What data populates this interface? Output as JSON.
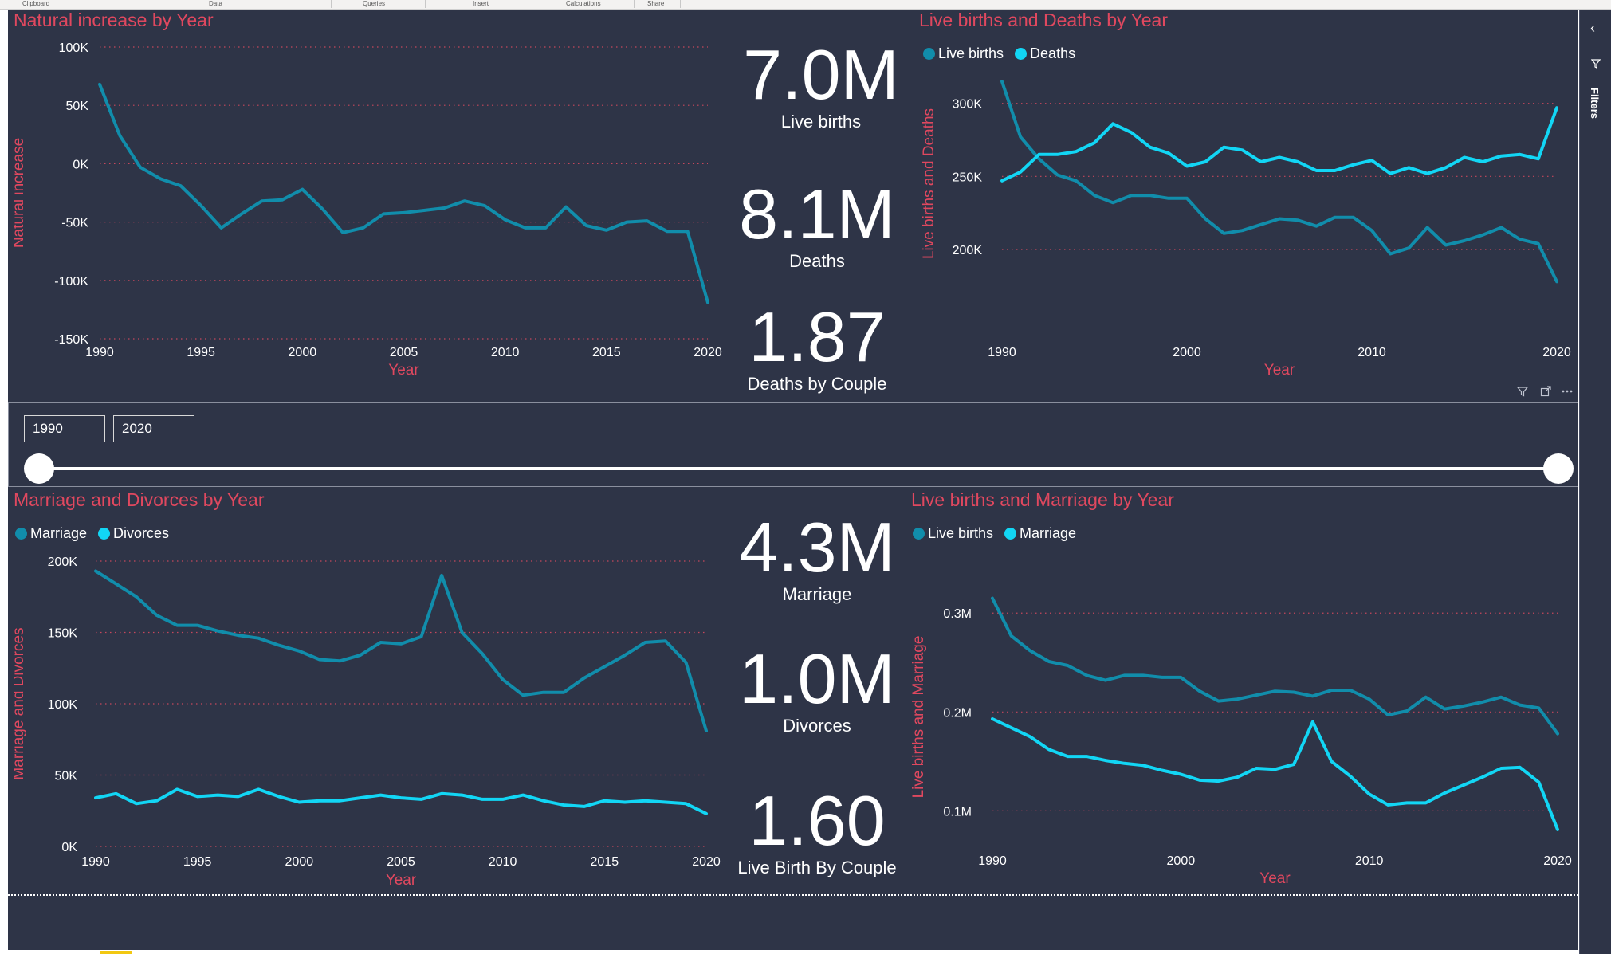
{
  "ribbon": {
    "tabs": [
      "Clipboard",
      "Data",
      "Queries",
      "Insert",
      "Calculations",
      "Share"
    ]
  },
  "filters_pane": {
    "label": "Filters",
    "collapse_icon": "chevron-left-icon",
    "funnel_icon": "funnel-icon"
  },
  "colors": {
    "canvas": "#2e3447",
    "title": "#e0485f",
    "series_dark": "#118dab",
    "series_light": "#12d6f5",
    "text": "#ffffff"
  },
  "kpis": [
    {
      "value": "7.0M",
      "label": "Live births"
    },
    {
      "value": "8.1M",
      "label": "Deaths"
    },
    {
      "value": "1.87",
      "label": "Deaths by Couple"
    },
    {
      "value": "4.3M",
      "label": "Marriage"
    },
    {
      "value": "1.0M",
      "label": "Divorces"
    },
    {
      "value": "1.60",
      "label": "Live Birth By Couple"
    }
  ],
  "slicer": {
    "start": "1990",
    "end": "2020"
  },
  "visual_header_icons": [
    "filter-icon",
    "focus-mode-icon",
    "more-options-icon"
  ],
  "charts": {
    "natural_increase": {
      "title": "Natural increase by Year",
      "chart_data": {
        "type": "line",
        "title": "Natural increase by Year",
        "xlabel": "Year",
        "ylabel": "Natural increase",
        "x": [
          1990,
          1991,
          1992,
          1993,
          1994,
          1995,
          1996,
          1997,
          1998,
          1999,
          2000,
          2001,
          2002,
          2003,
          2004,
          2005,
          2006,
          2007,
          2008,
          2009,
          2010,
          2011,
          2012,
          2013,
          2014,
          2015,
          2016,
          2017,
          2018,
          2019,
          2020
        ],
        "series": [
          {
            "values": [
              68000,
              24000,
              -3000,
              -13000,
              -19000,
              -36000,
              -55000,
              -43000,
              -32000,
              -31000,
              -22000,
              -39000,
              -59000,
              -55000,
              -43000,
              -42000,
              -40000,
              -38000,
              -32000,
              -36000,
              -48000,
              -55000,
              -55000,
              -37000,
              -53000,
              -57000,
              -50000,
              -49000,
              -58000,
              -58000,
              -119000
            ]
          }
        ],
        "xticks": [
          "1990",
          "1995",
          "2000",
          "2005",
          "2010",
          "2015",
          "2020"
        ],
        "yticks": [
          "100K",
          "50K",
          "0K",
          "-50K",
          "-100K",
          "-150K"
        ],
        "ylim": [
          -150000,
          100000
        ],
        "xlim": [
          1990,
          2020
        ],
        "grid": true
      }
    },
    "births_deaths": {
      "title": "Live births and Deaths by Year",
      "legend": [
        "Live births",
        "Deaths"
      ],
      "chart_data": {
        "type": "line",
        "title": "Live births and Deaths by Year",
        "xlabel": "Year",
        "ylabel": "Live births and Deaths",
        "x": [
          1990,
          1991,
          1992,
          1993,
          1994,
          1995,
          1996,
          1997,
          1998,
          1999,
          2000,
          2001,
          2002,
          2003,
          2004,
          2005,
          2006,
          2007,
          2008,
          2009,
          2010,
          2011,
          2012,
          2013,
          2014,
          2015,
          2016,
          2017,
          2018,
          2019,
          2020
        ],
        "series": [
          {
            "name": "Live births",
            "values": [
              315000,
              277000,
              262000,
              251000,
              247000,
              237000,
              232000,
              237000,
              237000,
              235000,
              235000,
              221000,
              211000,
              213000,
              217000,
              221000,
              220000,
              216000,
              222000,
              222000,
              213000,
              197000,
              201000,
              215000,
              203000,
              206000,
              210000,
              215000,
              207000,
              204000,
              178000
            ]
          },
          {
            "name": "Deaths",
            "values": [
              247000,
              253000,
              265000,
              265000,
              267000,
              273000,
              286000,
              280000,
              270000,
              266000,
              257000,
              260000,
              270000,
              268000,
              260000,
              263000,
              260000,
              254000,
              254000,
              258000,
              261000,
              252000,
              256000,
              252000,
              256000,
              263000,
              260000,
              264000,
              265000,
              262000,
              297000
            ]
          }
        ],
        "xticks": [
          "1990",
          "2000",
          "2010",
          "2020"
        ],
        "yticks": [
          "300K",
          "250K",
          "200K"
        ],
        "ylim": [
          170000,
          320000
        ],
        "xlim": [
          1990,
          2020
        ],
        "grid": true,
        "legend_position": "top-left"
      }
    },
    "marriage_divorces": {
      "title": "Marriage and Divorces by Year",
      "legend": [
        "Marriage",
        "Divorces"
      ],
      "chart_data": {
        "type": "line",
        "title": "Marriage and Divorces by Year",
        "xlabel": "Year",
        "ylabel": "Marriage and Divorces",
        "x": [
          1990,
          1991,
          1992,
          1993,
          1994,
          1995,
          1996,
          1997,
          1998,
          1999,
          2000,
          2001,
          2002,
          2003,
          2004,
          2005,
          2006,
          2007,
          2008,
          2009,
          2010,
          2011,
          2012,
          2013,
          2014,
          2015,
          2016,
          2017,
          2018,
          2019,
          2020
        ],
        "series": [
          {
            "name": "Marriage",
            "values": [
              193000,
              184000,
              175000,
              162000,
              155000,
              155000,
              151000,
              148000,
              146000,
              141000,
              137000,
              131000,
              130000,
              134000,
              143000,
              142000,
              147000,
              190000,
              150000,
              135000,
              117000,
              106000,
              108000,
              108000,
              118000,
              126000,
              134000,
              143000,
              144000,
              129000,
              81000
            ]
          },
          {
            "name": "Divorces",
            "values": [
              34000,
              37000,
              30000,
              32000,
              40000,
              35000,
              36000,
              35000,
              40000,
              35000,
              31000,
              32000,
              32000,
              34000,
              36000,
              34000,
              33000,
              37000,
              36000,
              33000,
              33000,
              36000,
              32000,
              29000,
              28000,
              32000,
              31000,
              32000,
              31000,
              30000,
              23000
            ]
          }
        ],
        "xticks": [
          "1990",
          "1995",
          "2000",
          "2005",
          "2010",
          "2015",
          "2020"
        ],
        "yticks": [
          "200K",
          "150K",
          "100K",
          "50K",
          "0K"
        ],
        "ylim": [
          0,
          200000
        ],
        "xlim": [
          1990,
          2020
        ],
        "grid": true,
        "legend_position": "top-left"
      }
    },
    "births_marriage": {
      "title": "Live births and Marriage by Year",
      "legend": [
        "Live births",
        "Marriage"
      ],
      "chart_data": {
        "type": "line",
        "title": "Live births and Marriage by Year",
        "xlabel": "Year",
        "ylabel": "Live births and Marriage",
        "x": [
          1990,
          1991,
          1992,
          1993,
          1994,
          1995,
          1996,
          1997,
          1998,
          1999,
          2000,
          2001,
          2002,
          2003,
          2004,
          2005,
          2006,
          2007,
          2008,
          2009,
          2010,
          2011,
          2012,
          2013,
          2014,
          2015,
          2016,
          2017,
          2018,
          2019,
          2020
        ],
        "series": [
          {
            "name": "Live births",
            "values": [
              315000,
              277000,
              262000,
              251000,
              247000,
              237000,
              232000,
              237000,
              237000,
              235000,
              235000,
              221000,
              211000,
              213000,
              217000,
              221000,
              220000,
              216000,
              222000,
              222000,
              213000,
              197000,
              201000,
              215000,
              203000,
              206000,
              210000,
              215000,
              207000,
              204000,
              178000
            ]
          },
          {
            "name": "Marriage",
            "values": [
              193000,
              184000,
              175000,
              162000,
              155000,
              155000,
              151000,
              148000,
              146000,
              141000,
              137000,
              131000,
              130000,
              134000,
              143000,
              142000,
              147000,
              190000,
              150000,
              135000,
              117000,
              106000,
              108000,
              108000,
              118000,
              126000,
              134000,
              143000,
              144000,
              129000,
              81000
            ]
          }
        ],
        "xticks": [
          "1990",
          "2000",
          "2010",
          "2020"
        ],
        "yticks": [
          "0.3M",
          "0.2M",
          "0.1M"
        ],
        "ylim": [
          60000,
          330000
        ],
        "xlim": [
          1990,
          2020
        ],
        "grid": true,
        "legend_position": "top-left"
      }
    }
  }
}
